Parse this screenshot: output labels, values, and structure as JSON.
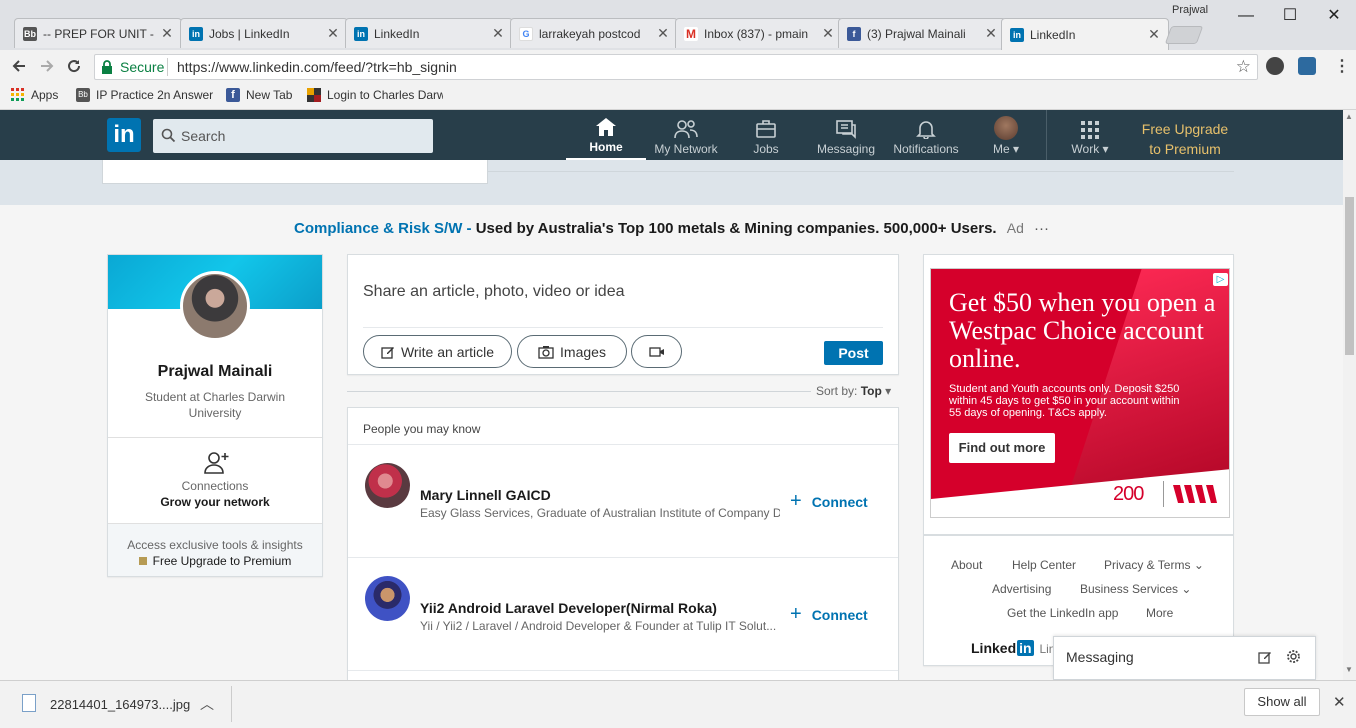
{
  "browser": {
    "tabs": [
      {
        "label": "-- PREP FOR UNIT -",
        "favicon": "Bb"
      },
      {
        "label": "Jobs | LinkedIn",
        "favicon": "in"
      },
      {
        "label": "LinkedIn",
        "favicon": "in"
      },
      {
        "label": "larrakeyah postcod",
        "favicon": "G"
      },
      {
        "label": "Inbox (837) - pmain",
        "favicon": "M"
      },
      {
        "label": "(3) Prajwal Mainali",
        "favicon": "f"
      },
      {
        "label": "LinkedIn",
        "favicon": "in"
      }
    ],
    "profile": "Prajwal",
    "secure_label": "Secure",
    "url": "https://www.linkedin.com/feed/?trk=hb_signin",
    "bookmarks": [
      "Apps",
      "IP Practice 2n Answer",
      "New Tab",
      "Login to Charles Darw"
    ]
  },
  "nav": {
    "search_placeholder": "Search",
    "items": [
      "Home",
      "My Network",
      "Jobs",
      "Messaging",
      "Notifications",
      "Me",
      "Work"
    ],
    "premium_line1": "Free Upgrade",
    "premium_line2": "to Premium"
  },
  "ad_banner": {
    "brand": "Compliance & Risk S/W -",
    "text": "Used by Australia's Top 100 metals & Mining companies. 500,000+ Users.",
    "ad_label": "Ad",
    "more": "···"
  },
  "profile": {
    "name": "Prajwal Mainali",
    "headline": "Student at Charles Darwin University",
    "connections_label": "Connections",
    "grow_label": "Grow your network",
    "premium_text": "Access exclusive tools & insights",
    "premium_link": "Free Upgrade to Premium"
  },
  "share": {
    "placeholder": "Share an article, photo, video or idea",
    "write_article": "Write an article",
    "images": "Images",
    "post": "Post",
    "sort_label": "Sort by:",
    "sort_value": "Top"
  },
  "pymk": {
    "title": "People you may know",
    "people": [
      {
        "name": "Mary Linnell GAICD",
        "headline": "Easy Glass Services, Graduate of Australian Institute of Company D...",
        "action": "Connect"
      },
      {
        "name": "Yii2 Android Laravel Developer(Nirmal Roka)",
        "headline": "Yii / Yii2 / Laravel / Android Developer & Founder at Tulip IT Solut...",
        "action": "Connect"
      }
    ]
  },
  "side_ad": {
    "headline": "Get $50 when you open a Westpac Choice account online.",
    "body": "Student and Youth accounts only. Deposit $250 within 45 days to get $50 in your account within 55 days of opening. T&Cs apply.",
    "cta": "Find out more",
    "badge": "200"
  },
  "footer": {
    "about": "About",
    "help": "Help Center",
    "privacy": "Privacy & Terms",
    "advertising": "Advertising",
    "business": "Business Services",
    "app": "Get the LinkedIn app",
    "more": "More",
    "brand_word": "Linked",
    "brand_in": "in",
    "brand_trail": "Link"
  },
  "messaging": {
    "label": "Messaging"
  },
  "download": {
    "filename": "22814401_164973....jpg",
    "show_all": "Show all"
  },
  "colors": {
    "linkedin_nav": "#283e4a",
    "linkedin_blue": "#0073b1",
    "westpac_red": "#d5002b",
    "premium_gold": "#e7c06b"
  }
}
